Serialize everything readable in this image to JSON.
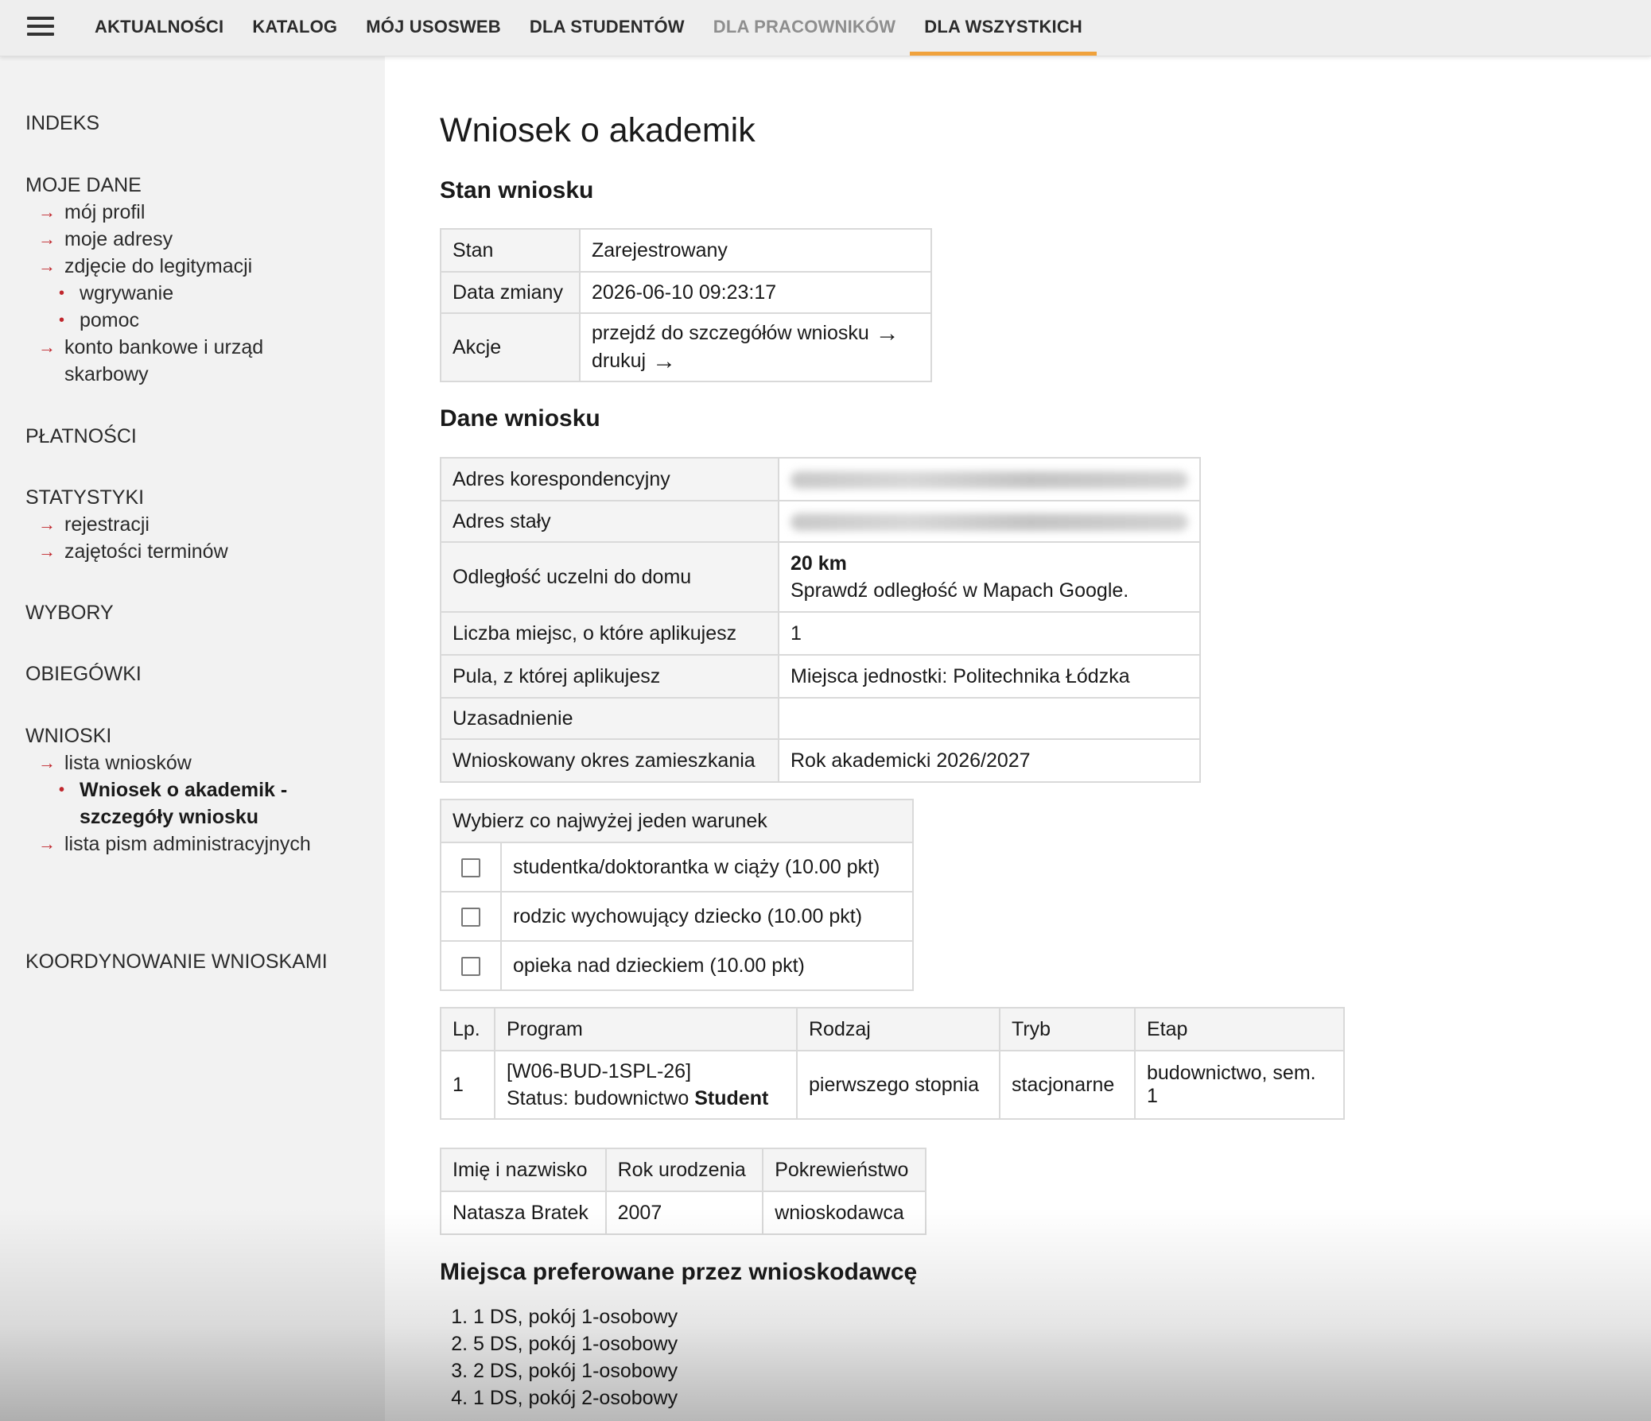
{
  "nav": {
    "items": [
      {
        "label": "AKTUALNOŚCI"
      },
      {
        "label": "KATALOG"
      },
      {
        "label": "MÓJ USOSWEB"
      },
      {
        "label": "DLA STUDENTÓW"
      },
      {
        "label": "DLA PRACOWNIKÓW"
      },
      {
        "label": "DLA WSZYSTKICH"
      }
    ],
    "active_color": "#f0a23c"
  },
  "sidebar": {
    "indeks": "INDEKS",
    "moje_dane": "MOJE DANE",
    "moj_profil": "mój profil",
    "moje_adresy": "moje adresy",
    "zdjecie": "zdjęcie do legitymacji",
    "wgrywanie": "wgrywanie",
    "pomoc": "pomoc",
    "konto_1": "konto bankowe i urząd",
    "konto_2": "skarbowy",
    "platnosci": "PŁATNOŚCI",
    "statystyki": "STATYSTYKI",
    "rejestracji": "rejestracji",
    "zajetosci": "zajętości terminów",
    "wybory": "WYBORY",
    "obiegowki": "OBIEGÓWKI",
    "wnioski": "WNIOSKI",
    "lista_wnioskow": "lista wniosków",
    "current_1": "Wniosek o akademik -",
    "current_2": "szczegóły wniosku",
    "lista_pism": "lista pism administracyjnych",
    "koordynowanie": "KOORDYNOWANIE WNIOSKAMI",
    "arrow_color": "#c0272d"
  },
  "page": {
    "title": "Wniosek o akademik",
    "stan_heading": "Stan wniosku",
    "dane_heading": "Dane wniosku",
    "miejsca_heading": "Miejsca preferowane przez wnioskodawcę"
  },
  "stan": {
    "stan_label": "Stan",
    "stan_value": "Zarejestrowany",
    "data_label": "Data zmiany",
    "data_value": "2026-06-10 09:23:17",
    "akcje_label": "Akcje",
    "szczegoly_link": "przejdź do szczegółów wniosku",
    "drukuj_link": "drukuj"
  },
  "dane": {
    "adres_kor_label": "Adres korespondencyjny",
    "adres_staly_label": "Adres stały",
    "odleglosc_label": "Odległość uczelni do domu",
    "odleglosc_value": "20 km",
    "odleglosc_link": "Sprawdź odległość w Mapach Google.",
    "liczba_label": "Liczba miejsc, o które aplikujesz",
    "liczba_value": "1",
    "pula_label": "Pula, z której aplikujesz",
    "pula_value": "Miejsca jednostki: Politechnika Łódzka",
    "uzasadnienie_label": "Uzasadnienie",
    "okres_label": "Wnioskowany okres zamieszkania",
    "okres_value": "Rok akademicki 2026/2027"
  },
  "warunki": {
    "header": "Wybierz co najwyżej jeden warunek",
    "options": [
      "studentka/doktorantka w ciąży (10.00 pkt)",
      "rodzic wychowujący dziecko (10.00 pkt)",
      "opieka nad dzieckiem (10.00 pkt)"
    ]
  },
  "programy": {
    "headers": [
      "Lp.",
      "Program",
      "Rodzaj",
      "Tryb",
      "Etap"
    ],
    "rows": [
      {
        "lp": "1",
        "program_code": "[W06-BUD-1SPL-26]",
        "status_prefix": "Status: budownictwo",
        "status_bold": "Student",
        "rodzaj": "pierwszego stopnia",
        "tryb": "stacjonarne",
        "etap": "budownictwo, sem. 1"
      }
    ]
  },
  "osoby": {
    "headers": [
      "Imię i nazwisko",
      "Rok urodzenia",
      "Pokrewieństwo"
    ],
    "rows": [
      {
        "name": "Natasza Bratek",
        "year": "2007",
        "relation": "wnioskodawca"
      }
    ]
  },
  "preferencje": [
    "1 DS, pokój 1-osobowy",
    "5 DS, pokój 1-osobowy",
    "2 DS, pokój 1-osobowy",
    "1 DS, pokój 2-osobowy"
  ]
}
